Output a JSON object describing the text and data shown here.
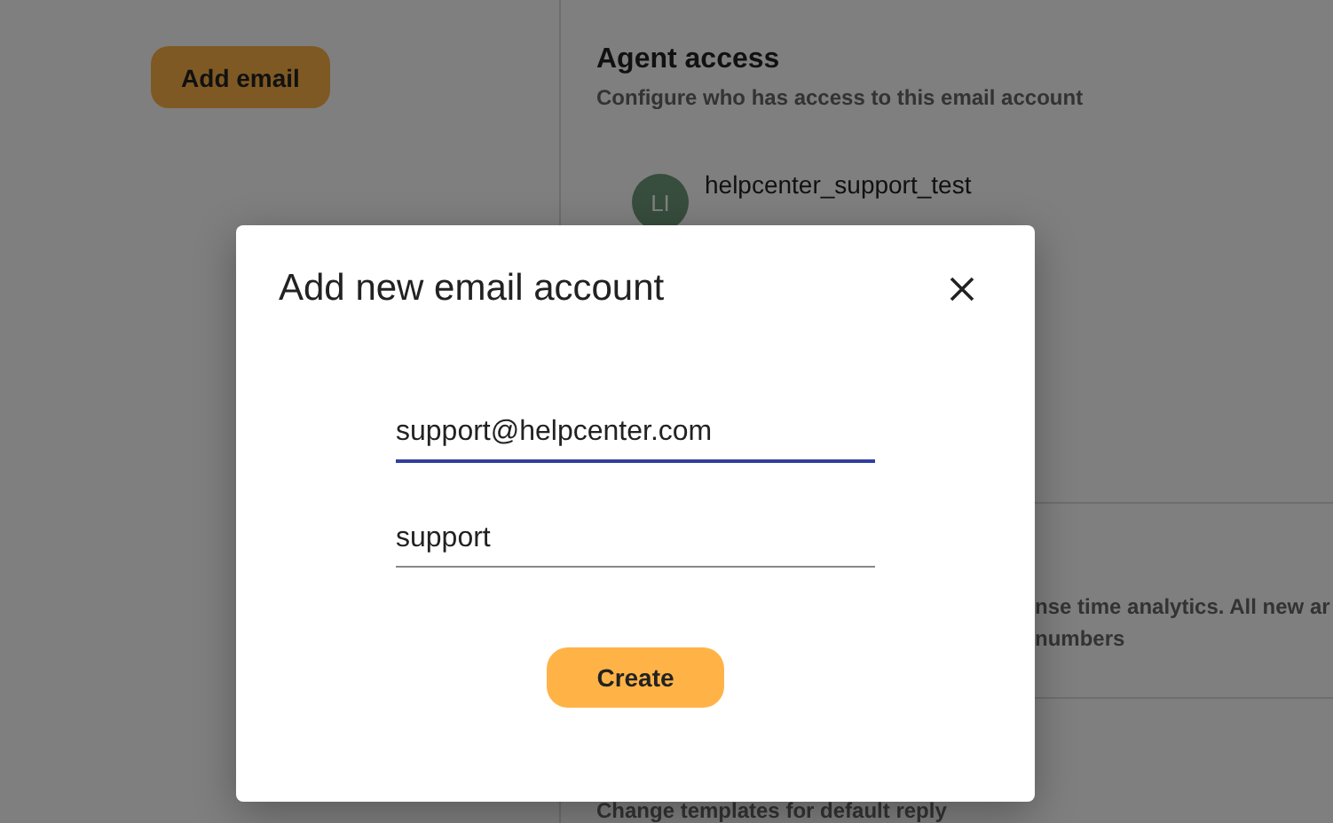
{
  "page": {
    "add_button": "Add email",
    "agent_access": {
      "title": "Agent access",
      "subtitle": "Configure who has access to this email account",
      "agents": [
        {
          "initials": "LI",
          "name": "helpcenter_support_test"
        }
      ]
    },
    "analytics_lines": [
      "nse time analytics. All new ar",
      "numbers"
    ],
    "templates_subtitle": "Change templates for default reply"
  },
  "dialog": {
    "title": "Add new email account",
    "fields": [
      {
        "value": "support@helpcenter.com",
        "focused": true
      },
      {
        "value": "support",
        "focused": false
      }
    ],
    "create_button": "Create"
  }
}
